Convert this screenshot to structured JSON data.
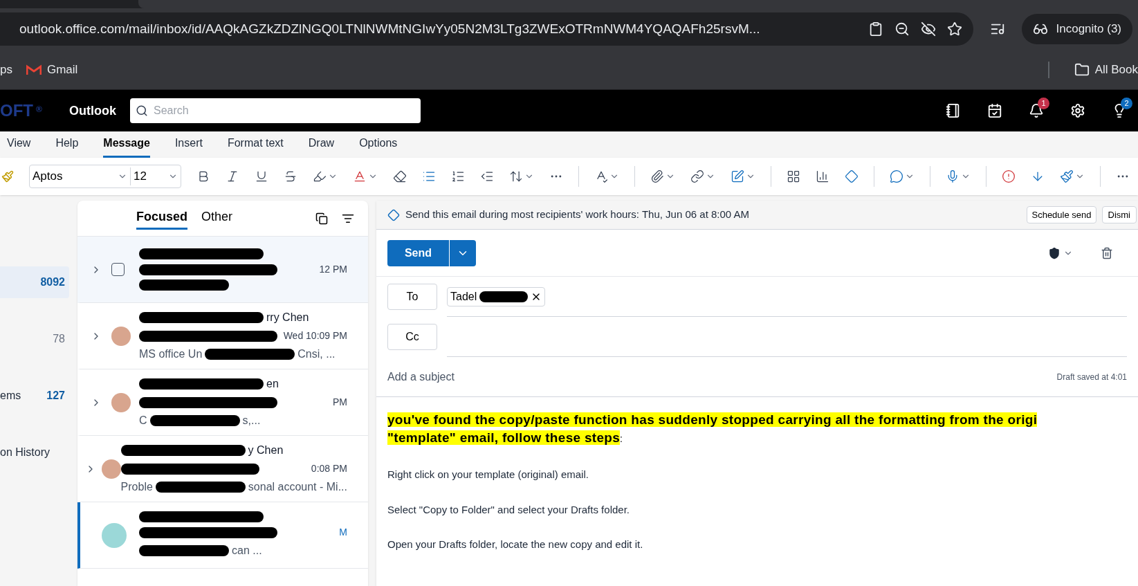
{
  "browser": {
    "address": "outlook.office.com/mail/inbox/id/AAQkAGZkZDZlNGQ0LTNlNWMtNGIwYy05N2M3LTg3ZWExOTRmNWM4YQAQAFh25rsvM...",
    "incognito": "Incognito (3)",
    "bookmarks": [
      {
        "label": "ps",
        "kind": "text"
      },
      {
        "label": "Gmail",
        "kind": "gmail"
      }
    ],
    "all_bookmarks": "All Book"
  },
  "header": {
    "brand": "OFT",
    "brand_mark": "®",
    "app": "Outlook",
    "search_placeholder": "Search",
    "notification_count": "1",
    "tips_count": "2"
  },
  "ribbon_tabs": [
    {
      "label": "View",
      "selected": false
    },
    {
      "label": "Help",
      "selected": false
    },
    {
      "label": "Message",
      "selected": true
    },
    {
      "label": "Insert",
      "selected": false
    },
    {
      "label": "Format text",
      "selected": false
    },
    {
      "label": "Draw",
      "selected": false
    },
    {
      "label": "Options",
      "selected": false
    }
  ],
  "ribbon": {
    "font": "Aptos",
    "size": "12"
  },
  "folders": [
    {
      "count": "8092",
      "selected": true,
      "unread": true
    },
    {
      "count": "78",
      "selected": false,
      "unread": false
    },
    {
      "label": "ems",
      "count": "127",
      "selected": false,
      "unread": true
    },
    {
      "label": "on History",
      "selected": false
    }
  ],
  "mail_tabs": [
    {
      "label": "Focused",
      "selected": true
    },
    {
      "label": "Other",
      "selected": false
    }
  ],
  "messages": [
    {
      "selected": false,
      "hover": true,
      "kind": "checkbox",
      "time": "12 PM"
    },
    {
      "selected": false,
      "hover": false,
      "kind": "photo",
      "sender": "rry Chen",
      "time": "Wed 10:09 PM",
      "preview": "MS office Un",
      "preview_end": "Cnsi, ..."
    },
    {
      "selected": false,
      "hover": false,
      "kind": "photo",
      "sender": "en",
      "time": "PM",
      "preview": "C",
      "preview_end": "s,..."
    },
    {
      "selected": false,
      "hover": false,
      "kind": "photo",
      "sender": "y Chen",
      "time": "0:08 PM",
      "preview": "Proble",
      "preview_end": "sonal account - Mi..."
    },
    {
      "selected": true,
      "hover": false,
      "kind": "initials",
      "time": "M",
      "preview_end": "can ..."
    }
  ],
  "compose": {
    "suggestion": "Send this email during most recipients' work hours: Thu, Jun 06 at 8:00 AM",
    "schedule": "Schedule send",
    "dismiss": "Dismi",
    "send": "Send",
    "to_label": "To",
    "recipient": "Tadel",
    "cc_label": "Cc",
    "subject_placeholder": "Add a subject",
    "draft_status": "Draft saved at 4:01",
    "heading": [
      "you've found the copy/paste function has suddenly stopped carrying all the formatting from the origi",
      "\"template\" email, follow these steps"
    ],
    "heading_end": ":",
    "paragraphs": [
      "Right click on your template (original) email.",
      "Select \"Copy to Folder\" and select your Drafts folder.",
      "Open your Drafts folder, locate the new copy and edit it."
    ]
  }
}
